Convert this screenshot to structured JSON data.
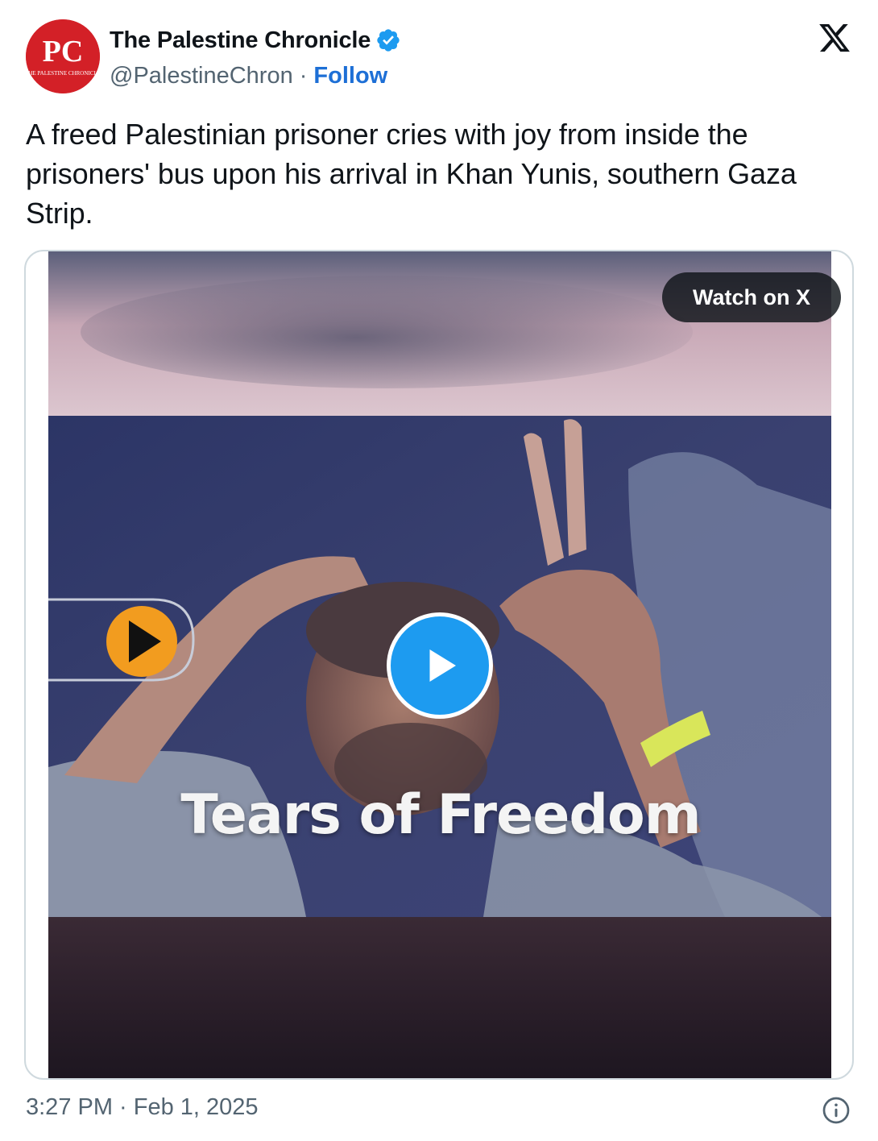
{
  "author": {
    "avatar_text": "PC",
    "avatar_subtext": "THE PALESTINE CHRONICLE",
    "display_name": "The Palestine Chronicle",
    "handle": "@PalestineChron",
    "separator": "·",
    "follow_label": "Follow",
    "verified": true
  },
  "tweet": {
    "text": "A freed Palestinian prisoner cries with joy from inside the prisoners' bus upon his arrival in Khan Yunis, southern Gaza Strip."
  },
  "media": {
    "watch_label": "Watch on X",
    "overlay_title": "Tears of Freedom"
  },
  "footer": {
    "timestamp": "3:27 PM · Feb 1, 2025"
  },
  "icons": {
    "brand": "x-logo-icon",
    "verified": "verified-badge-icon",
    "play": "play-icon",
    "info": "info-icon"
  },
  "colors": {
    "brand_red": "#d32027",
    "verified_blue": "#1d9bf0",
    "follow_blue": "#1d6fd6",
    "play_blue": "#1d9bf0",
    "text_secondary": "#536471"
  }
}
